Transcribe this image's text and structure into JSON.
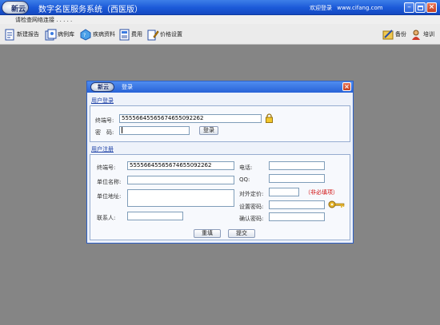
{
  "app": {
    "logo_text": "新云",
    "title": "数字名医服务系统（西医版）",
    "welcome_text": "欢迎登录",
    "website": "www.cifang.com"
  },
  "status": {
    "text": "请检查网络连接 . . . . ."
  },
  "toolbar": {
    "left": [
      {
        "label": "新建报告"
      },
      {
        "label": "病例库"
      },
      {
        "label": "疾病资料"
      },
      {
        "label": "费用"
      },
      {
        "label": "价格设置"
      }
    ],
    "right": [
      {
        "label": "备份"
      },
      {
        "label": "培训"
      }
    ]
  },
  "dialog": {
    "logo_text": "新云",
    "title": "登录",
    "login": {
      "section_title": "用户登录",
      "terminal_label": "终端号:",
      "terminal_value": "55556645565674655092262",
      "password_label": "密　码:",
      "password_value": "",
      "login_button": "登录"
    },
    "register": {
      "section_title": "用户注册",
      "terminal_label": "终端号:",
      "terminal_value": "55556645565674655092262",
      "unit_name_label": "单位名称:",
      "unit_address_label": "单位地址:",
      "contact_label": "联系人:",
      "phone_label": "电话:",
      "qq_label": "QQ:",
      "price_label": "对外定价:",
      "required_note": "（非必填项）",
      "set_password_label": "设置密码:",
      "confirm_password_label": "确认密码:",
      "reset_button": "重填",
      "submit_button": "提交"
    }
  }
}
